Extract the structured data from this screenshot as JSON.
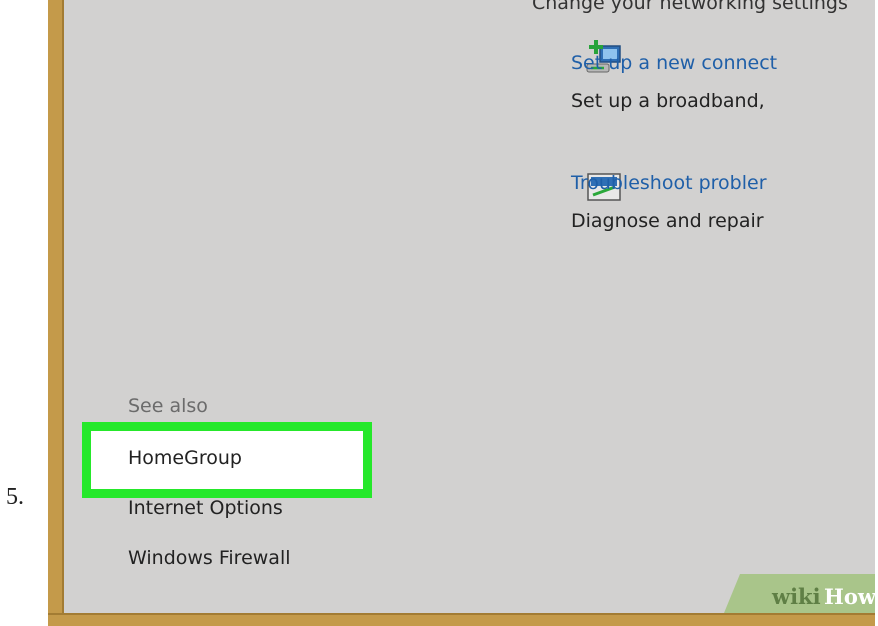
{
  "step_number": "5.",
  "heading_fragment": "Change your networking settings",
  "tasks": [
    {
      "link": "Set up a new connect",
      "desc": "Set up a broadband,",
      "icon": "new-connection-icon"
    },
    {
      "link": "Troubleshoot probler",
      "desc": "Diagnose and repair",
      "icon": "troubleshoot-icon"
    }
  ],
  "see_also": {
    "label": "See also",
    "items": [
      "HomeGroup",
      "Internet Options",
      "Windows Firewall"
    ],
    "highlighted": "HomeGroup"
  },
  "watermark": {
    "wiki": "wiki",
    "how": "How"
  },
  "colors": {
    "highlight": "#25e82a",
    "link": "#1f5fa8",
    "panel": "#d2d1d0",
    "frame": "#c49a4a"
  }
}
